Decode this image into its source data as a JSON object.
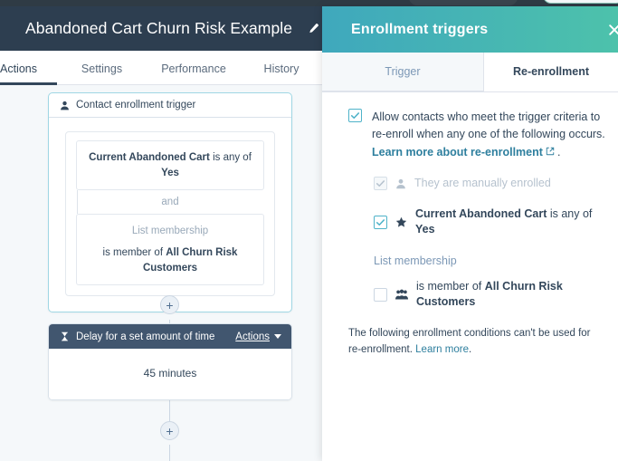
{
  "app": {
    "title": "Abandoned Cart Churn Risk Example",
    "edit_icon": "pencil-icon",
    "tabs": [
      {
        "label": "Actions",
        "active": true
      },
      {
        "label": "Settings",
        "active": false
      },
      {
        "label": "Performance",
        "active": false
      },
      {
        "label": "History",
        "active": false
      }
    ]
  },
  "flow": {
    "trigger_card": {
      "header_icon": "contact-icon",
      "header_label": "Contact enrollment trigger",
      "filters": [
        {
          "property": "Current Abandoned Cart",
          "operator": "is any of",
          "value": "Yes"
        }
      ],
      "conjunction": "and",
      "list_filter": {
        "label": "List membership",
        "operator": "is member of",
        "value": "All Churn Risk Customers"
      }
    },
    "add_node_icon": "plus-icon",
    "delay_card": {
      "header_icon": "hourglass-icon",
      "header_label": "Delay for a set amount of time",
      "actions_label": "Actions",
      "actions_caret": "chevron-down-icon",
      "body_value": "45 minutes"
    }
  },
  "panel": {
    "title": "Enrollment triggers",
    "close_icon": "close-icon",
    "tabs": [
      {
        "label": "Trigger",
        "active": false
      },
      {
        "label": "Re-enrollment",
        "active": true
      }
    ],
    "main_option": {
      "checked": true,
      "text_line1": "Allow contacts who meet the trigger criteria to",
      "text_line2": "re-enroll when any one of the following occurs.",
      "link_label": "Learn more about re-enrollment",
      "link_icon": "external-link-icon",
      "trailing_punct": "."
    },
    "options": [
      {
        "checked": true,
        "disabled": true,
        "icon": "contact-icon",
        "label": "They are manually enrolled",
        "bold_prefix": "",
        "suffix": ""
      },
      {
        "checked": true,
        "disabled": false,
        "icon": "star-icon",
        "bold_prefix": "Current Abandoned Cart",
        "label": " is any of ",
        "suffix": "Yes"
      }
    ],
    "list_section": {
      "heading": "List membership",
      "checked": false,
      "icon": "list-members-icon",
      "label": "is member of ",
      "value": "All Churn Risk Customers"
    },
    "note": {
      "text": "The following enrollment conditions can't be used for re-enrollment.",
      "link_label": "Learn more",
      "trailing_punct": "."
    }
  },
  "colors": {
    "app_header_bg": "#2d3e50",
    "panel_gradient_left": "#3fa8bd",
    "panel_gradient_right": "#4dc2ab",
    "accent_teal": "#4fb3c9",
    "link_teal": "#2e7f9e",
    "canvas_bg": "#f5f8fa",
    "delay_header_bg": "#41566f"
  }
}
